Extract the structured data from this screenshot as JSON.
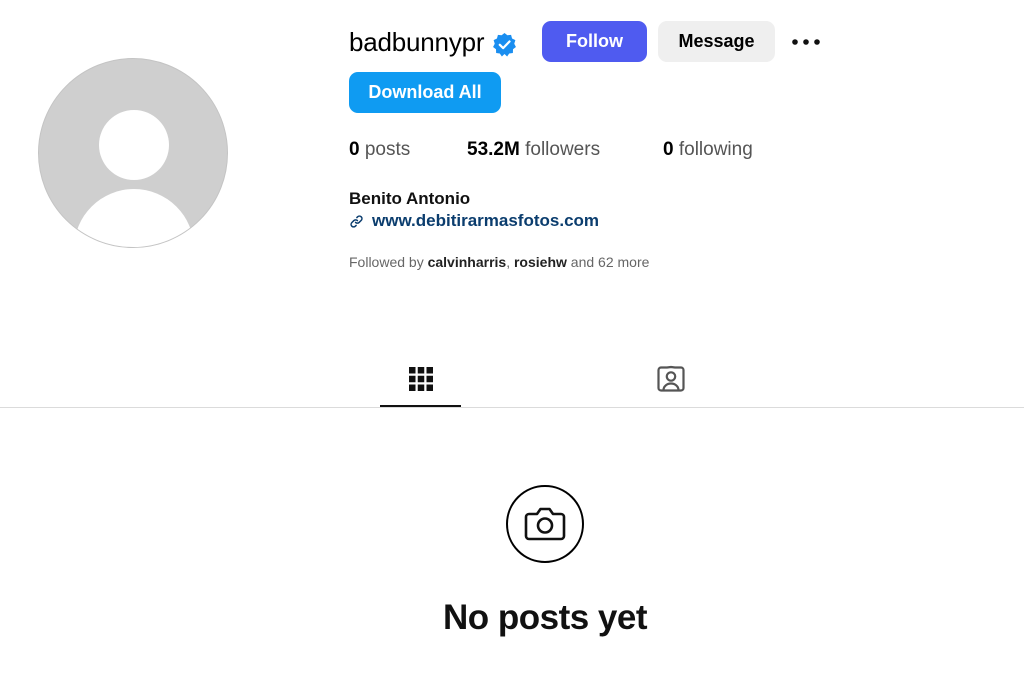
{
  "profile": {
    "username": "badbunnyp​r",
    "verified_icon": "verified-badge-icon",
    "full_name": "Benito Antonio",
    "link": "www.debitirarmasfotos.com",
    "link_icon": "link-icon"
  },
  "actions": {
    "follow_label": "Follow",
    "message_label": "Message",
    "more_icon": "more-options-icon",
    "download_label": "Download All"
  },
  "stats": {
    "posts_count": "0",
    "posts_label": "posts",
    "followers_count": "53.2M",
    "followers_label": "followers",
    "following_count": "0",
    "following_label": "following"
  },
  "followed_by": {
    "prefix": "Followed by",
    "accounts": [
      "calvinharris",
      "rosiehw"
    ],
    "separator": ",",
    "suffix": "and 62 more"
  },
  "tabs": [
    {
      "icon": "grid-icon",
      "active": true
    },
    {
      "icon": "tagged-icon",
      "active": false
    }
  ],
  "empty_state": {
    "icon": "camera-icon",
    "title": "No posts yet"
  },
  "colors": {
    "follow_button": "#4f5bf0",
    "download_button": "#0f9bf2",
    "verified_badge": "#1a8ef0",
    "link_text": "#0b3d6e"
  }
}
